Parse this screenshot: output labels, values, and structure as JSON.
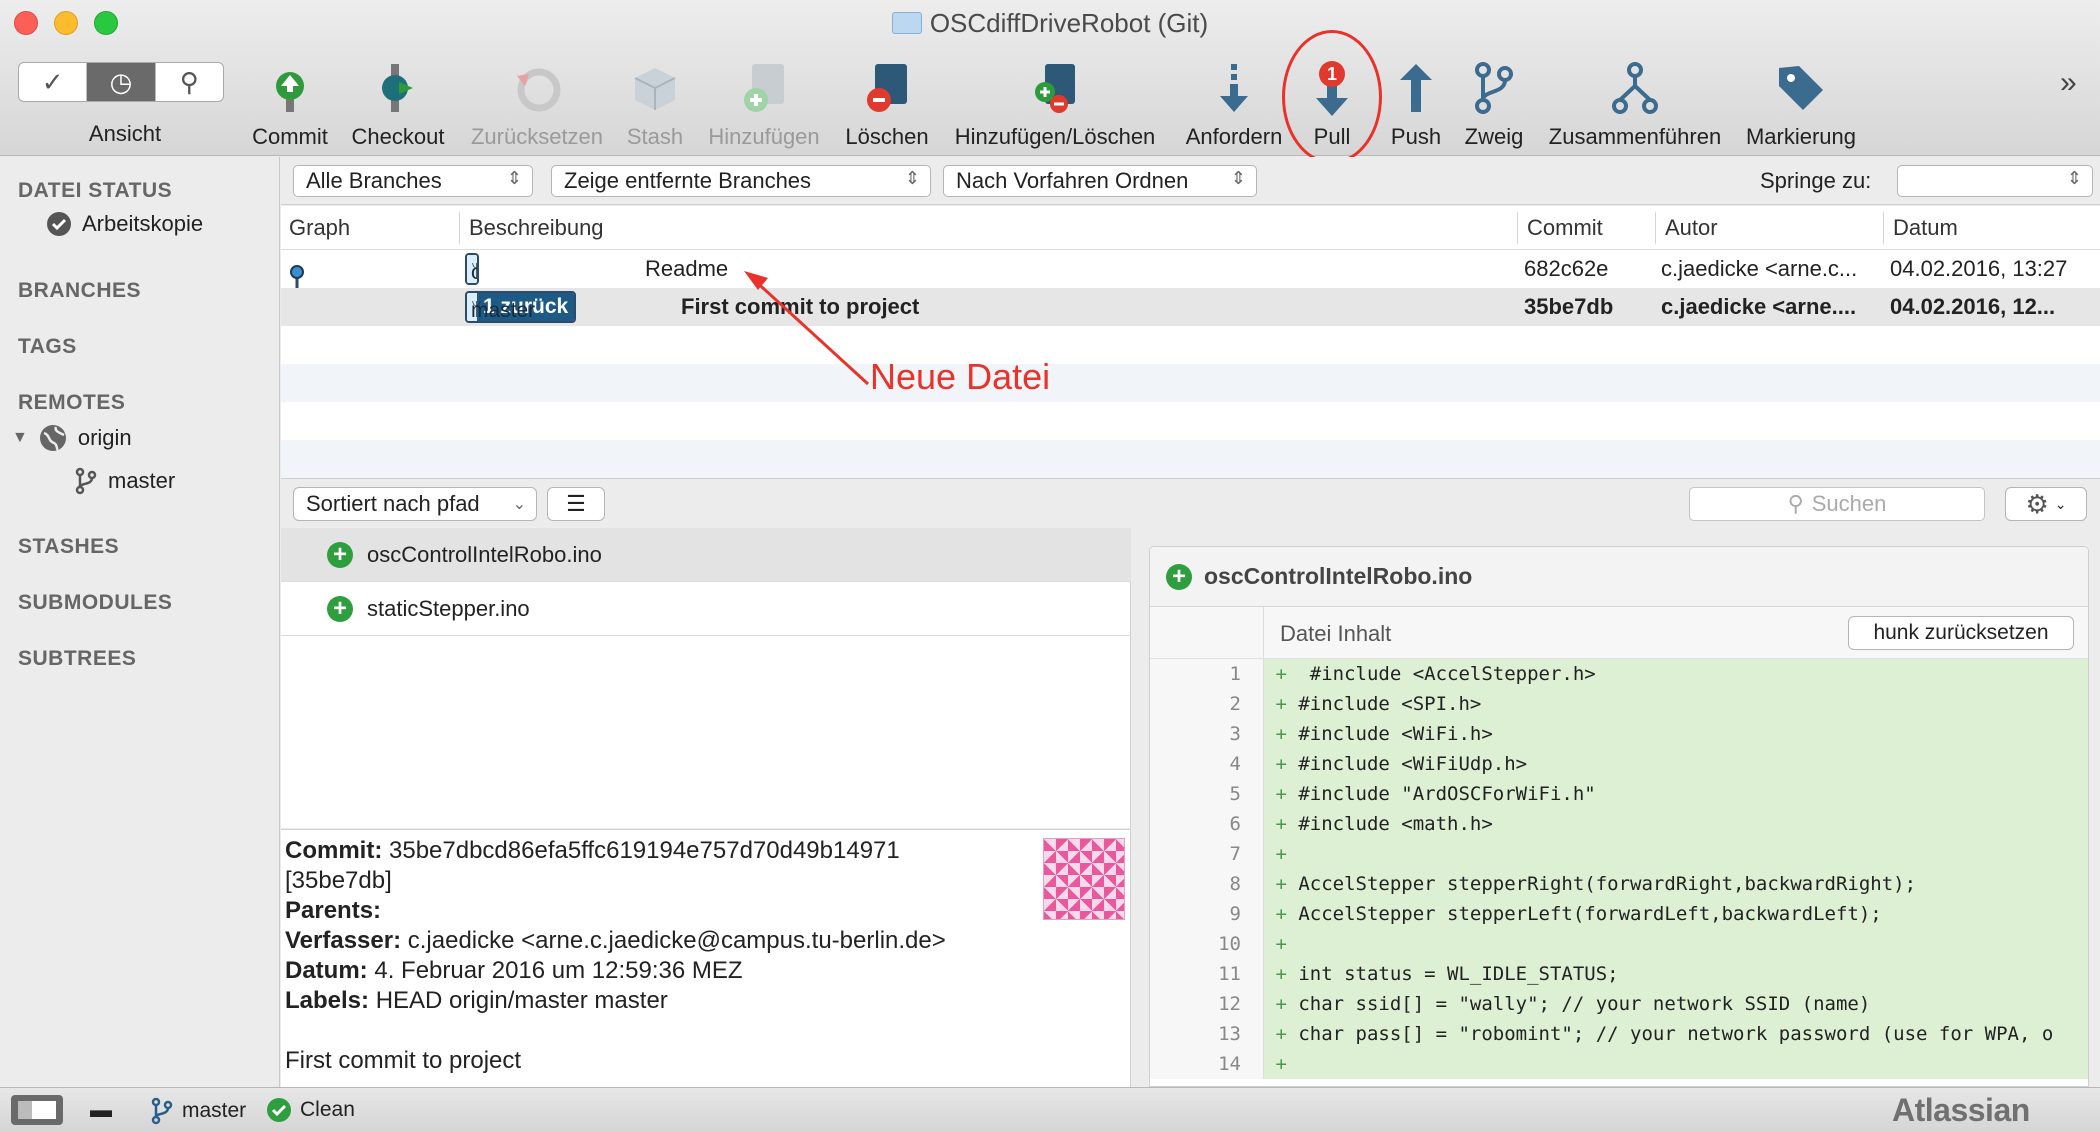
{
  "window": {
    "title": "OSCdiffDriveRobot (Git)"
  },
  "toolbar": {
    "view_label": "Ansicht",
    "buttons": [
      {
        "label": "Commit",
        "enabled": true
      },
      {
        "label": "Checkout",
        "enabled": true
      },
      {
        "label": "Zurücksetzen",
        "enabled": false
      },
      {
        "label": "Stash",
        "enabled": false
      },
      {
        "label": "Hinzufügen",
        "enabled": false
      },
      {
        "label": "Löschen",
        "enabled": true
      },
      {
        "label": "Hinzufügen/Löschen",
        "enabled": true
      },
      {
        "label": "Anfordern",
        "enabled": true
      },
      {
        "label": "Pull",
        "enabled": true,
        "badge": "1"
      },
      {
        "label": "Push",
        "enabled": true
      },
      {
        "label": "Zweig",
        "enabled": true
      },
      {
        "label": "Zusammenführen",
        "enabled": true
      },
      {
        "label": "Markierung",
        "enabled": true
      }
    ],
    "more": "»"
  },
  "sidebar": {
    "file_status": "DATEI STATUS",
    "working_copy": "Arbeitskopie",
    "branches": "BRANCHES",
    "tags": "TAGS",
    "remotes": "REMOTES",
    "remote_name": "origin",
    "remote_branch": "master",
    "stashes": "STASHES",
    "submodules": "SUBMODULES",
    "subtrees": "SUBTREES"
  },
  "filters": {
    "branches": "Alle Branches",
    "remote": "Zeige entfernte Branches",
    "order": "Nach Vorfahren Ordnen",
    "jump_label": "Springe zu:",
    "jump_value": ""
  },
  "commit_list": {
    "headers": {
      "graph": "Graph",
      "desc": "Beschreibung",
      "commit": "Commit",
      "author": "Autor",
      "date": "Datum"
    },
    "rows": [
      {
        "tag1": "origin/master",
        "tag2": "",
        "desc": "Readme",
        "commit": "682c62e",
        "author": "c.jaedicke <arne.c...",
        "date": "04.02.2016, 13:27"
      },
      {
        "tag1": "master",
        "tag2": "1 zurück",
        "desc": "First commit to project",
        "commit": "35be7db",
        "author": "c.jaedicke <arne....",
        "date": "04.02.2016, 12..."
      }
    ]
  },
  "annotation": {
    "text": "Neue Datei",
    "color": "#e8322a"
  },
  "file_bar": {
    "sort": "Sortiert nach pfad",
    "search_placeholder": "Suchen"
  },
  "files": [
    {
      "name": "oscControlIntelRobo.ino",
      "status": "added"
    },
    {
      "name": "staticStepper.ino",
      "status": "added"
    }
  ],
  "details": {
    "commit_label": "Commit:",
    "commit_hash": "35be7dbcd86efa5ffc619194e757d70d49b14971",
    "short_hash": "[35be7db]",
    "parents_label": "Parents:",
    "author_label": "Verfasser:",
    "author": "c.jaedicke <arne.c.jaedicke@campus.tu-berlin.de>",
    "date_label": "Datum:",
    "date": "4. Februar 2016 um 12:59:36 MEZ",
    "labels_label": "Labels:",
    "labels": "HEAD origin/master master",
    "message": "First commit to project"
  },
  "diff": {
    "file": "oscControlIntelRobo.ino",
    "hunk_title": "Datei Inhalt",
    "hunk_button": "hunk zurücksetzen",
    "lines": [
      {
        "n": "1",
        "t": " #include <AccelStepper.h>"
      },
      {
        "n": "2",
        "t": "#include <SPI.h>"
      },
      {
        "n": "3",
        "t": "#include <WiFi.h>"
      },
      {
        "n": "4",
        "t": "#include <WiFiUdp.h>"
      },
      {
        "n": "5",
        "t": "#include \"ArdOSCForWiFi.h\""
      },
      {
        "n": "6",
        "t": "#include <math.h>"
      },
      {
        "n": "7",
        "t": ""
      },
      {
        "n": "8",
        "t": "AccelStepper stepperRight(forwardRight,backwardRight);"
      },
      {
        "n": "9",
        "t": "AccelStepper stepperLeft(forwardLeft,backwardLeft);"
      },
      {
        "n": "10",
        "t": ""
      },
      {
        "n": "11",
        "t": "int status = WL_IDLE_STATUS;"
      },
      {
        "n": "12",
        "t": "char ssid[] = \"wally\"; // your network SSID (name)"
      },
      {
        "n": "13",
        "t": "char pass[] = \"robomint\"; // your network password (use for WPA, o"
      },
      {
        "n": "14",
        "t": ""
      }
    ]
  },
  "status": {
    "branch": "master",
    "state": "Clean",
    "brand": "Atlassian"
  },
  "colors": {
    "added": "#2e9e3e",
    "tag_dark": "#1d5a85",
    "diff_bg": "#ddf0d4",
    "highlight": "#e8322a"
  }
}
